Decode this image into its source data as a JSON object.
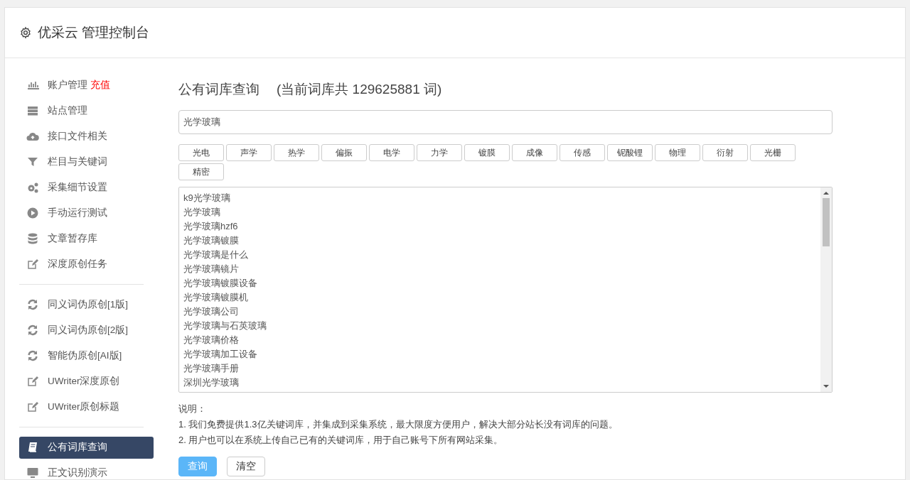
{
  "header": {
    "title": "优采云 管理控制台"
  },
  "sidebar": {
    "groups": [
      {
        "items": [
          {
            "label": "账户管理",
            "badge": "充值",
            "selected": false
          },
          {
            "label": "站点管理",
            "selected": false
          },
          {
            "label": "接口文件相关",
            "selected": false
          },
          {
            "label": "栏目与关键词",
            "selected": false
          },
          {
            "label": "采集细节设置",
            "selected": false
          },
          {
            "label": "手动运行测试",
            "selected": false
          },
          {
            "label": "文章暂存库",
            "selected": false
          },
          {
            "label": "深度原创任务",
            "selected": false
          }
        ]
      },
      {
        "items": [
          {
            "label": "同义词伪原创[1版]",
            "selected": false
          },
          {
            "label": "同义词伪原创[2版]",
            "selected": false
          },
          {
            "label": "智能伪原创[AI版]",
            "selected": false
          },
          {
            "label": "UWriter深度原创",
            "selected": false
          },
          {
            "label": "UWriter原创标题",
            "selected": false
          }
        ]
      },
      {
        "items": [
          {
            "label": "公有词库查询",
            "selected": true
          },
          {
            "label": "正文识别演示",
            "selected": false
          }
        ]
      }
    ]
  },
  "main": {
    "title": "公有词库查询",
    "subtitle": "(当前词库共 129625881 词)",
    "search": {
      "value": "光学玻璃"
    },
    "tags": [
      "光电",
      "声学",
      "热学",
      "偏振",
      "电学",
      "力学",
      "镀膜",
      "成像",
      "传感",
      "铌酸锂",
      "物理",
      "衍射",
      "光栅",
      "精密"
    ],
    "results": [
      "k9光学玻璃",
      "光学玻璃",
      "光学玻璃hzf6",
      "光学玻璃镀膜",
      "光学玻璃是什么",
      "光学玻璃镜片",
      "光学玻璃镀膜设备",
      "光学玻璃镀膜机",
      "光学玻璃公司",
      "光学玻璃与石英玻璃",
      "光学玻璃价格",
      "光学玻璃加工设备",
      "光学玻璃手册",
      "深圳光学玻璃"
    ],
    "notes_title": "说明：",
    "notes": [
      "1. 我们免费提供1.3亿关键词库，并集成到采集系统，最大限度方便用户，解决大部分站长没有词库的问题。",
      "2. 用户也可以在系统上传自己已有的关键词库，用于自己账号下所有网站采集。"
    ],
    "buttons": [
      {
        "label": "查询",
        "kind": "primary"
      },
      {
        "label": "清空",
        "kind": "default"
      }
    ]
  }
}
